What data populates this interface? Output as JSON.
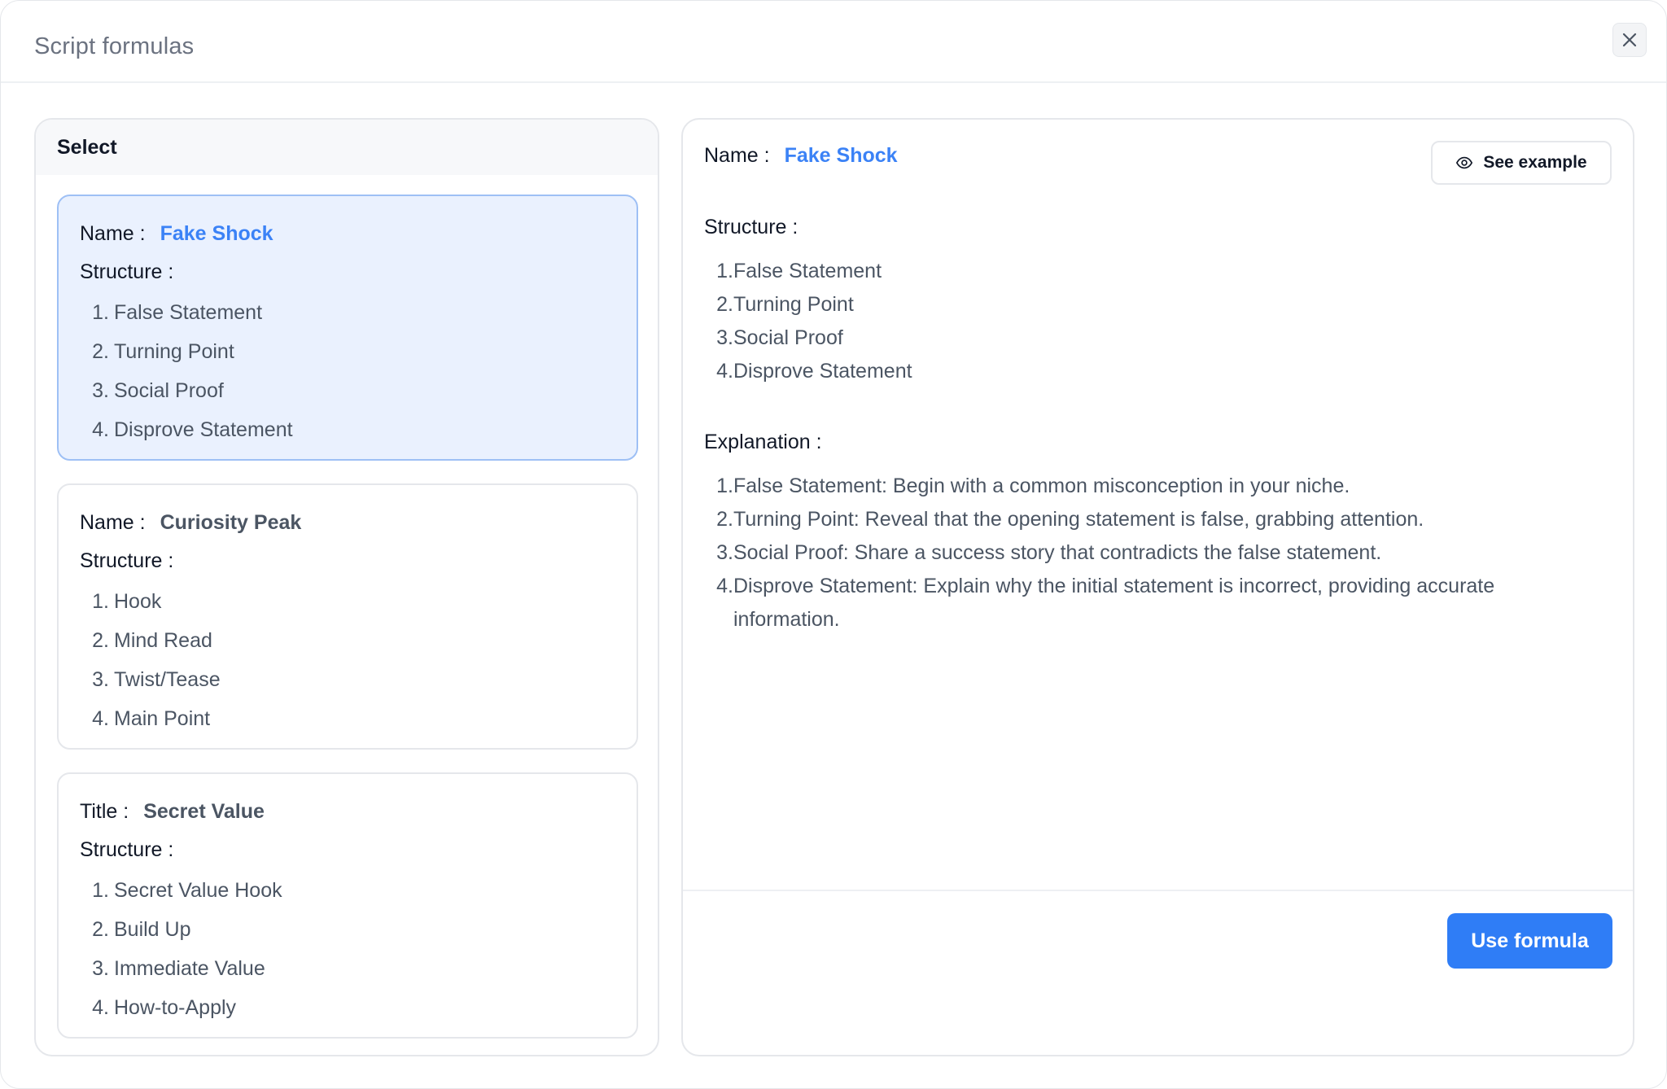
{
  "modal": {
    "title": "Script formulas"
  },
  "left_panel": {
    "header": "Select",
    "cards": [
      {
        "key_label": "Name :",
        "name": "Fake Shock",
        "structure_label": "Structure :",
        "items": [
          "False Statement",
          "Turning Point",
          "Social Proof",
          "Disprove Statement"
        ]
      },
      {
        "key_label": "Name :",
        "name": "Curiosity Peak",
        "structure_label": "Structure :",
        "items": [
          "Hook",
          "Mind Read",
          "Twist/Tease",
          "Main Point"
        ]
      },
      {
        "key_label": "Title :",
        "name": "Secret Value",
        "structure_label": "Structure :",
        "items": [
          "Secret Value Hook",
          "Build Up",
          "Immediate Value",
          "How-to-Apply"
        ]
      }
    ]
  },
  "detail": {
    "name_label": "Name :",
    "name": "Fake Shock",
    "see_example_label": "See example",
    "structure_label": "Structure :",
    "structure_items": [
      "False Statement",
      "Turning Point",
      "Social Proof",
      "Disprove Statement"
    ],
    "explanation_label": "Explanation :",
    "explanation_items": [
      "False Statement: Begin with a common misconception in your niche.",
      "Turning Point: Reveal that the opening statement is false, grabbing attention.",
      "Social Proof: Share a success story that contradicts the false statement.",
      "Disprove Statement: Explain why the initial statement is incorrect, providing accurate information."
    ],
    "use_formula_label": "Use formula"
  },
  "numbers": [
    "1.",
    "2.",
    "3.",
    "4."
  ],
  "colors": {
    "accent": "#2f7df6",
    "selected_bg": "#eaf1fe",
    "selected_border": "#9ec0f5"
  },
  "icons": {
    "close": "close-icon",
    "see_example": "eye-icon"
  }
}
